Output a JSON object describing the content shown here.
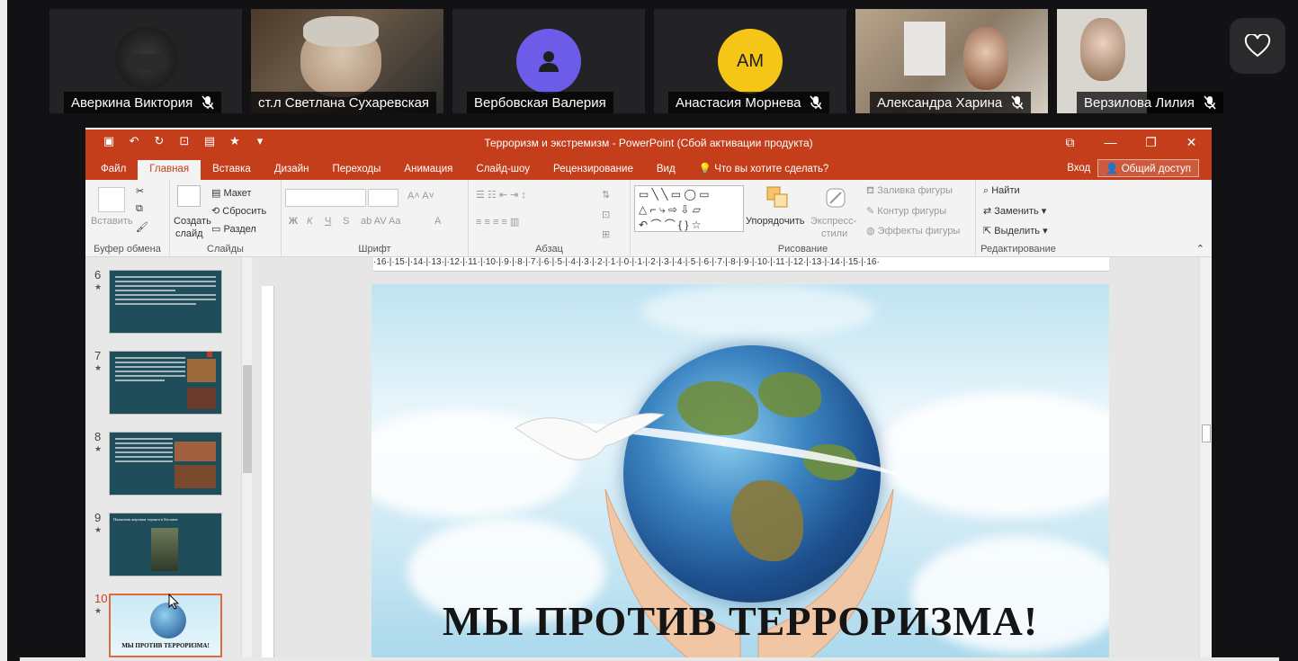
{
  "participants": [
    {
      "name": "Аверкина Виктория",
      "muted": true,
      "type": "photo"
    },
    {
      "name": "ст.л Светлана Сухаревская",
      "muted": false,
      "type": "photo"
    },
    {
      "name": "Вербовская Валерия",
      "muted": false,
      "type": "icon",
      "color": "#6c5ce7"
    },
    {
      "name": "Анастасия Морнева",
      "muted": true,
      "type": "initials",
      "initials": "АМ",
      "color": "#f5c518"
    },
    {
      "name": "Александра Харина",
      "muted": true,
      "type": "photo"
    },
    {
      "name": "Верзилова Лилия",
      "muted": true,
      "type": "photo"
    }
  ],
  "powerpoint": {
    "window_title": "Терроризм и экстремизм - PowerPoint (Сбой активации продукта)",
    "tabs": [
      {
        "label": "Файл",
        "active": false
      },
      {
        "label": "Главная",
        "active": true
      },
      {
        "label": "Вставка",
        "active": false
      },
      {
        "label": "Дизайн",
        "active": false
      },
      {
        "label": "Переходы",
        "active": false
      },
      {
        "label": "Анимация",
        "active": false
      },
      {
        "label": "Слайд-шоу",
        "active": false
      },
      {
        "label": "Рецензирование",
        "active": false
      },
      {
        "label": "Вид",
        "active": false
      }
    ],
    "tell_me": "Что вы хотите сделать?",
    "sign_in": "Вход",
    "share": "Общий доступ",
    "ribbon": {
      "clipboard": {
        "label": "Буфер обмена",
        "paste": "Вставить"
      },
      "slides": {
        "label": "Слайды",
        "new_slide_1": "Создать",
        "new_slide_2": "слайд",
        "layout": "Макет",
        "reset": "Сбросить",
        "section": "Раздел"
      },
      "font": {
        "label": "Шрифт",
        "bold": "Ж",
        "italic": "К",
        "underline": "Ч",
        "strike": "S"
      },
      "paragraph": {
        "label": "Абзац"
      },
      "drawing": {
        "label": "Рисование",
        "arrange": "Упорядочить",
        "quick_styles_1": "Экспресс-",
        "quick_styles_2": "стили",
        "fill": "Заливка фигуры",
        "outline": "Контур фигуры",
        "effects": "Эффекты фигуры"
      },
      "editing": {
        "label": "Редактирование",
        "find": "Найти",
        "replace": "Заменить",
        "select": "Выделить"
      }
    },
    "ruler_ticks": "·16·|·15·|·14·|·13·|·12·|·11·|·10·|·9·|·8·|·7·|·6·|·5·|·4·|·3·|·2·|·1·|·0·|·1·|·2·|·3·|·4·|·5·|·6·|·7·|·8·|·9·|·10·|·11·|·12·|·13·|·14·|·15·|·16·",
    "thumbnails": [
      {
        "num": "6",
        "star": "★",
        "theme": "text"
      },
      {
        "num": "7",
        "star": "★",
        "theme": "text-image"
      },
      {
        "num": "8",
        "star": "★",
        "theme": "text-image"
      },
      {
        "num": "9",
        "star": "★",
        "theme": "title-image",
        "title": "Памятник жертвам теракта в Беслане"
      },
      {
        "num": "10",
        "star": "★",
        "theme": "current",
        "title": "МЫ ПРОТИВ ТЕРРОРИЗМА!"
      }
    ],
    "slide_title": "МЫ ПРОТИВ ТЕРРОРИЗМА!"
  }
}
